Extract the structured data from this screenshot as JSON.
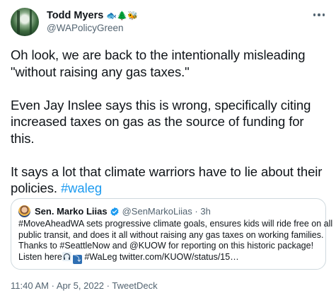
{
  "author": {
    "display_name": "Todd Myers",
    "emojis": "🐟🌲🐝",
    "handle": "@WAPolicyGreen"
  },
  "tweet": {
    "paragraph1_line1": "Oh look, we are back to the intentionally misleading",
    "paragraph1_line2": "\"without raising any gas taxes.\"",
    "paragraph2_line1": "Even Jay Inslee says this is wrong, specifically citing",
    "paragraph2_line2": "increased taxes on gas as the source of funding for",
    "paragraph2_line3": "this.",
    "paragraph3_line1": "It says a lot that climate warriors have to lie about their",
    "paragraph3_line2_prefix": "policies.",
    "hashtag": "#waleg"
  },
  "quoted_tweet": {
    "display_name": "Sen. Marko Liias",
    "handle": "@SenMarkoLiias",
    "separator": "·",
    "time": "3h",
    "line1": "#MoveAheadWA sets progressive climate goals, ensures kids will ride free on all",
    "line2": "public transit, and does it all without raising any gas taxes on working families.",
    "line3": "Thanks to #SeattleNow and @KUOW for reporting on this historic package!",
    "line4_prefix": "Listen here",
    "line4_suffix": " #WaLeg twitter.com/KUOW/status/15…"
  },
  "footer": {
    "time": "11:40 AM",
    "separator1": " · ",
    "date": "Apr 5, 2022",
    "separator2": " · ",
    "source": "TweetDeck"
  },
  "colors": {
    "link": "#1d9bf0",
    "secondary_text": "#536471",
    "border": "#cfd9de",
    "verified": "#1d9bf0"
  },
  "icons": [
    "more-icon",
    "verified-icon",
    "headphone-icon",
    "arrow-icon"
  ]
}
